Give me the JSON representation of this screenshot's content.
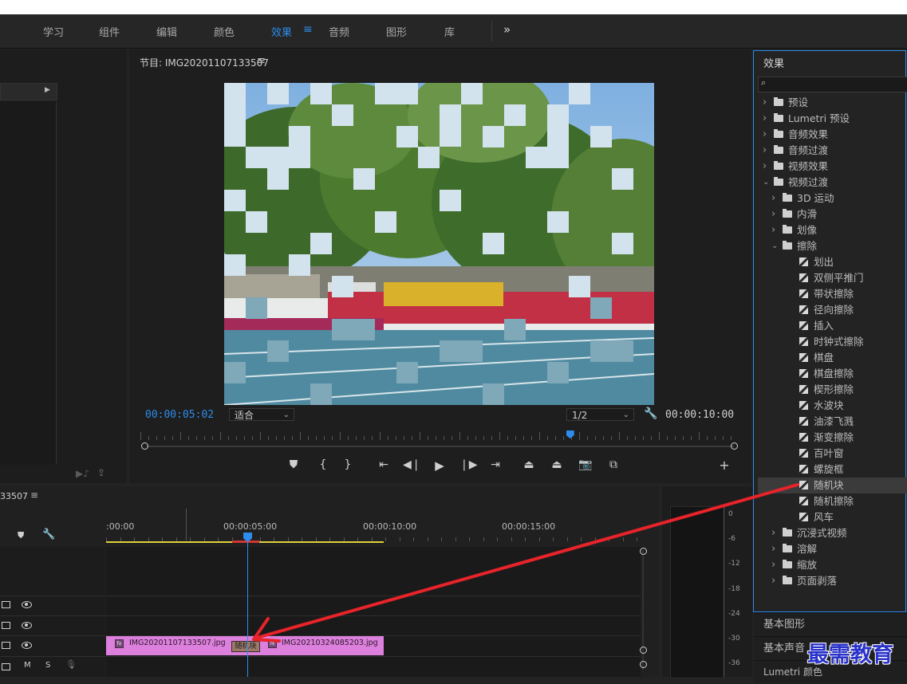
{
  "workspace_tabs": [
    "学习",
    "组件",
    "编辑",
    "颜色",
    "效果",
    "音频",
    "图形",
    "库"
  ],
  "active_tab_index": 4,
  "more_icon": "»",
  "program_monitor": {
    "title": "节目: IMG20201107133507",
    "current_time": "00:00:05:02",
    "zoom": "适合",
    "resolution": "1/2",
    "duration": "00:00:10:00",
    "playhead_fraction": 0.505
  },
  "timeline": {
    "sequence_label": "33507",
    "ruler_labels": [
      ":00:00",
      "00:00:05:00",
      "00:00:10:00",
      "00:00:15:00"
    ],
    "track_labels": {
      "m": "M",
      "s": "S"
    },
    "clip_a": "IMG20201107133507.jpg",
    "clip_b": "IMG20210324085203.jpg",
    "transition_label": "随机块"
  },
  "effects_panel": {
    "title": "效果",
    "items": [
      {
        "label": "预设",
        "depth": 0,
        "type": "preset",
        "expanded": false
      },
      {
        "label": "Lumetri 预设",
        "depth": 0,
        "type": "preset",
        "expanded": false
      },
      {
        "label": "音频效果",
        "depth": 0,
        "type": "folder",
        "expanded": false
      },
      {
        "label": "音频过渡",
        "depth": 0,
        "type": "folder",
        "expanded": false
      },
      {
        "label": "视频效果",
        "depth": 0,
        "type": "folder",
        "expanded": false
      },
      {
        "label": "视频过渡",
        "depth": 0,
        "type": "folder",
        "expanded": true
      },
      {
        "label": "3D 运动",
        "depth": 1,
        "type": "folder",
        "expanded": false
      },
      {
        "label": "内滑",
        "depth": 1,
        "type": "folder",
        "expanded": false
      },
      {
        "label": "划像",
        "depth": 1,
        "type": "folder",
        "expanded": false
      },
      {
        "label": "擦除",
        "depth": 1,
        "type": "folder",
        "expanded": true
      },
      {
        "label": "划出",
        "depth": 2,
        "type": "fx"
      },
      {
        "label": "双侧平推门",
        "depth": 2,
        "type": "fx"
      },
      {
        "label": "带状擦除",
        "depth": 2,
        "type": "fx"
      },
      {
        "label": "径向擦除",
        "depth": 2,
        "type": "fx"
      },
      {
        "label": "插入",
        "depth": 2,
        "type": "fx"
      },
      {
        "label": "时钟式擦除",
        "depth": 2,
        "type": "fx"
      },
      {
        "label": "棋盘",
        "depth": 2,
        "type": "fx"
      },
      {
        "label": "棋盘擦除",
        "depth": 2,
        "type": "fx"
      },
      {
        "label": "楔形擦除",
        "depth": 2,
        "type": "fx"
      },
      {
        "label": "水波块",
        "depth": 2,
        "type": "fx"
      },
      {
        "label": "油漆飞溅",
        "depth": 2,
        "type": "fx"
      },
      {
        "label": "渐变擦除",
        "depth": 2,
        "type": "fx"
      },
      {
        "label": "百叶窗",
        "depth": 2,
        "type": "fx"
      },
      {
        "label": "螺旋框",
        "depth": 2,
        "type": "fx"
      },
      {
        "label": "随机块",
        "depth": 2,
        "type": "fx",
        "selected": true
      },
      {
        "label": "随机擦除",
        "depth": 2,
        "type": "fx"
      },
      {
        "label": "风车",
        "depth": 2,
        "type": "fx"
      },
      {
        "label": "沉浸式视频",
        "depth": 1,
        "type": "folder",
        "expanded": false
      },
      {
        "label": "溶解",
        "depth": 1,
        "type": "folder",
        "expanded": false
      },
      {
        "label": "缩放",
        "depth": 1,
        "type": "folder",
        "expanded": false
      },
      {
        "label": "页面剥落",
        "depth": 1,
        "type": "folder",
        "expanded": false
      }
    ]
  },
  "side_panels": [
    "基本图形",
    "基本声音",
    "Lumetri 颜色"
  ],
  "meter_labels": [
    "0",
    "-6",
    "-12",
    "-18",
    "-24",
    "-30",
    "-36"
  ],
  "watermark": "最需教育",
  "colors": {
    "accent": "#2d8ceb",
    "clip": "#dd7fdc",
    "arrow": "#e8232a"
  }
}
